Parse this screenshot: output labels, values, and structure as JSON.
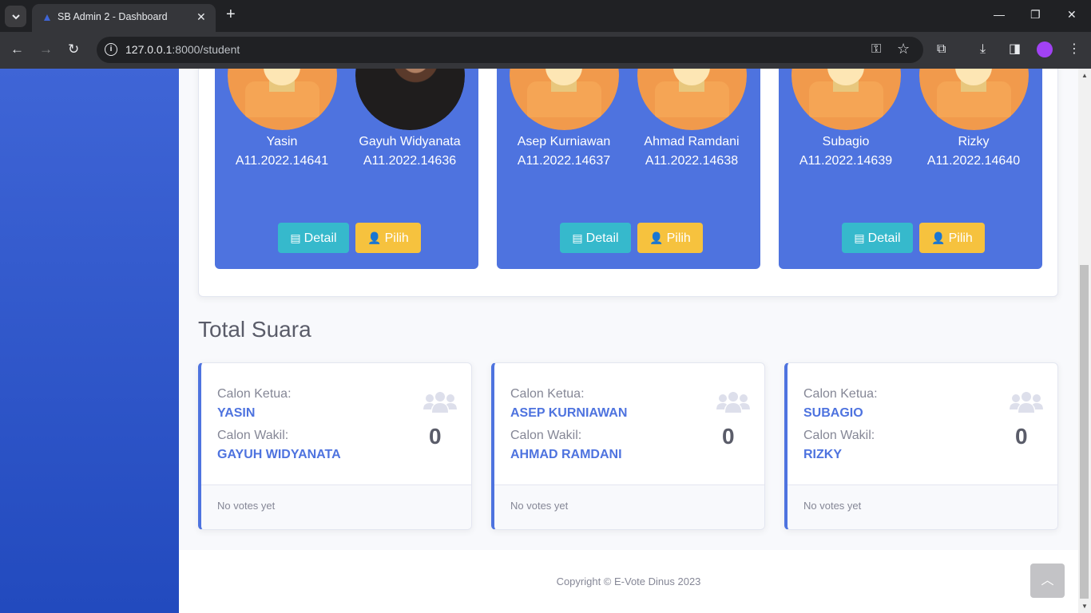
{
  "browser": {
    "tab_title": "SB Admin 2 - Dashboard",
    "url_host": "127.0.0.1",
    "url_path": ":8000/student",
    "icons": [
      "tab-search-icon",
      "close-icon",
      "new-tab-icon",
      "minimize-icon",
      "maximize-icon",
      "window-close-icon",
      "back-icon",
      "forward-icon",
      "reload-icon",
      "info-icon",
      "key-icon",
      "star-icon",
      "extensions-icon",
      "download-icon",
      "sidebar-icon",
      "profile-icon",
      "menu-icon"
    ]
  },
  "candidates": [
    {
      "ketua": {
        "name": "Yasin",
        "nim": "A11.2022.14641",
        "photo": "avatar-placeholder"
      },
      "wakil": {
        "name": "Gayuh Widyanata",
        "nim": "A11.2022.14636",
        "photo": "photo"
      },
      "detail_label": "Detail",
      "pilih_label": "Pilih"
    },
    {
      "ketua": {
        "name": "Asep Kurniawan",
        "nim": "A11.2022.14637",
        "photo": "avatar-placeholder"
      },
      "wakil": {
        "name": "Ahmad Ramdani",
        "nim": "A11.2022.14638",
        "photo": "avatar-placeholder"
      },
      "detail_label": "Detail",
      "pilih_label": "Pilih"
    },
    {
      "ketua": {
        "name": "Subagio",
        "nim": "A11.2022.14639",
        "photo": "avatar-placeholder"
      },
      "wakil": {
        "name": "Rizky",
        "nim": "A11.2022.14640",
        "photo": "avatar-placeholder"
      },
      "detail_label": "Detail",
      "pilih_label": "Pilih"
    }
  ],
  "total": {
    "title": "Total Suara",
    "cards": [
      {
        "ketua_label": "Calon Ketua:",
        "ketua": "YASIN",
        "wakil_label": "Calon Wakil:",
        "wakil": "GAYUH WIDYANATA",
        "count": "0",
        "footer": "No votes yet"
      },
      {
        "ketua_label": "Calon Ketua:",
        "ketua": "ASEP KURNIAWAN",
        "wakil_label": "Calon Wakil:",
        "wakil": "AHMAD RAMDANI",
        "count": "0",
        "footer": "No votes yet"
      },
      {
        "ketua_label": "Calon Ketua:",
        "ketua": "SUBAGIO",
        "wakil_label": "Calon Wakil:",
        "wakil": "RIZKY",
        "count": "0",
        "footer": "No votes yet"
      }
    ]
  },
  "footer": {
    "copyright": "Copyright © E-Vote Dinus 2023"
  },
  "colors": {
    "primary": "#4e73df",
    "info": "#36b9cc",
    "warning": "#f6c23e"
  }
}
